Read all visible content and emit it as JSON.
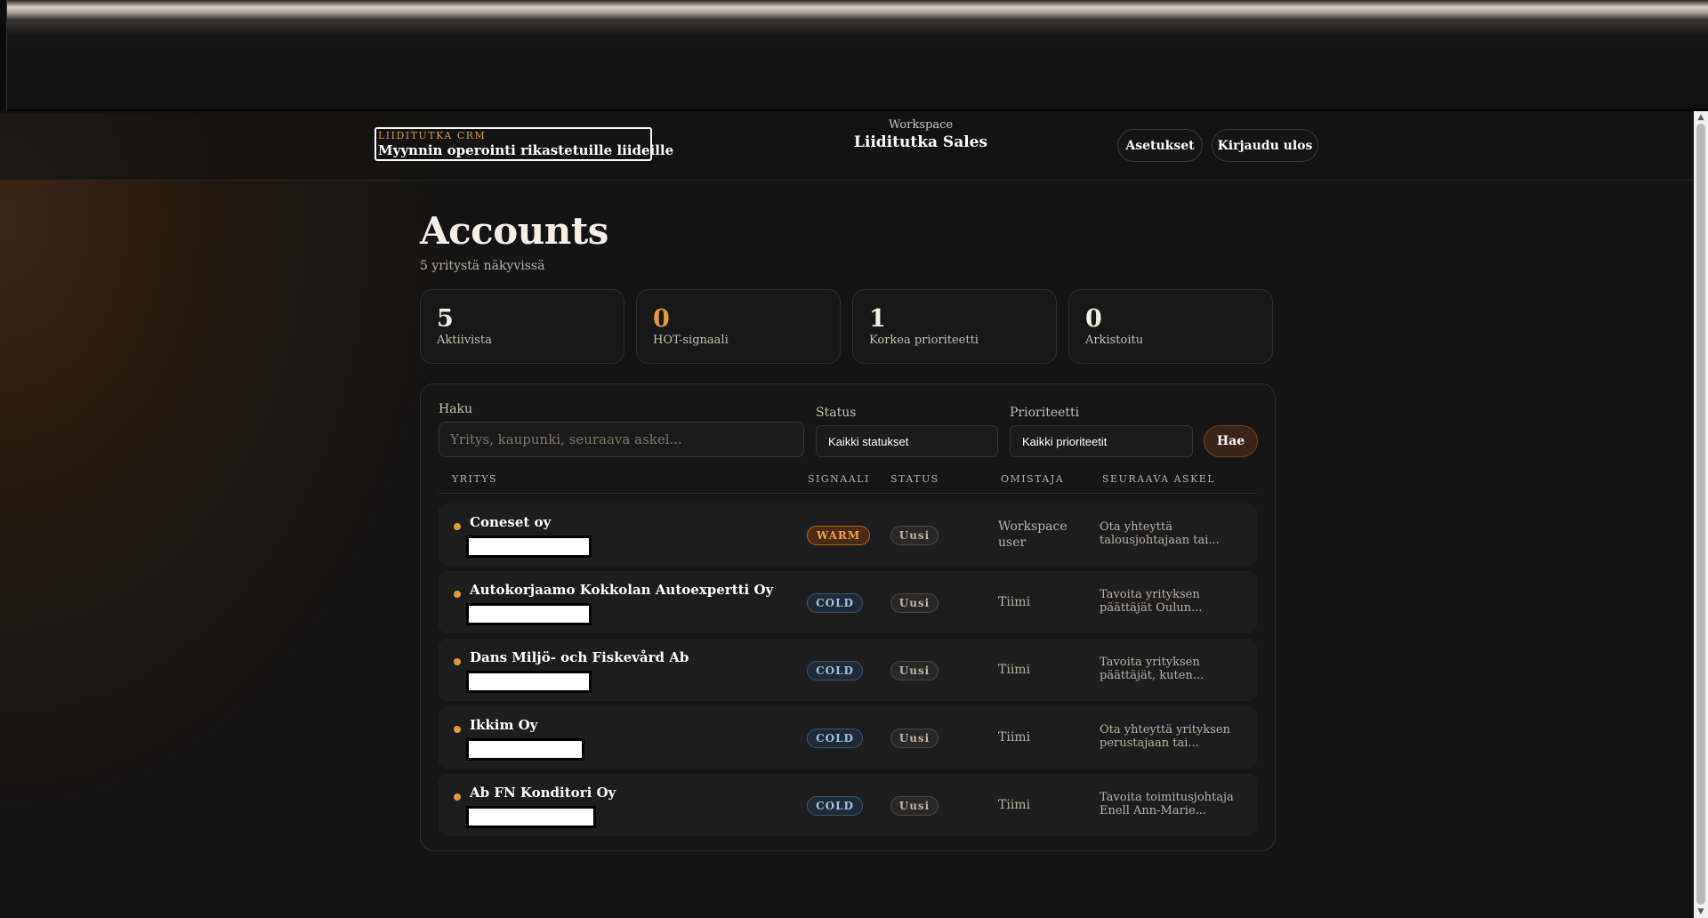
{
  "header": {
    "brand_kicker": "LIIDITUTKA CRM",
    "brand_title": "Myynnin operointi rikastetuille liideille",
    "workspace_label": "Workspace",
    "workspace_name": "Liiditutka Sales",
    "settings_label": "Asetukset",
    "logout_label": "Kirjaudu ulos"
  },
  "page": {
    "title": "Accounts",
    "subtitle": "5 yritystä näkyvissä"
  },
  "stats": [
    {
      "value": "5",
      "label": "Aktiivista"
    },
    {
      "value": "0",
      "label": "HOT-signaali"
    },
    {
      "value": "1",
      "label": "Korkea prioriteetti"
    },
    {
      "value": "0",
      "label": "Arkistoitu"
    }
  ],
  "filters": {
    "search_label": "Haku",
    "search_placeholder": "Yritys, kaupunki, seuraava askel...",
    "status_label": "Status",
    "status_value": "Kaikki statukset",
    "priority_label": "Prioriteetti",
    "priority_value": "Kaikki prioriteetit",
    "submit_label": "Hae"
  },
  "table": {
    "columns": [
      "YRITYS",
      "SIGNAALI",
      "STATUS",
      "OMISTAJA",
      "SEURAAVA ASKEL"
    ],
    "rows": [
      {
        "company": "Coneset oy",
        "signal": "WARM",
        "status": "Uusi",
        "owner_line1": "Workspace",
        "owner_line2": "user",
        "next_step": "Ota yhteyttä talousjohtajaan tai..."
      },
      {
        "company": "Autokorjaamo Kokkolan Autoexpertti Oy",
        "signal": "COLD",
        "status": "Uusi",
        "owner_line1": "Tiimi",
        "owner_line2": "",
        "next_step": "Tavoita yrityksen päättäjät Oulun..."
      },
      {
        "company": "Dans Miljö- och Fiskevård Ab",
        "signal": "COLD",
        "status": "Uusi",
        "owner_line1": "Tiimi",
        "owner_line2": "",
        "next_step": "Tavoita yrityksen päättäjät, kuten..."
      },
      {
        "company": "Ikkim Oy",
        "signal": "COLD",
        "status": "Uusi",
        "owner_line1": "Tiimi",
        "owner_line2": "",
        "next_step": "Ota yhteyttä yrityksen perustajaan tai..."
      },
      {
        "company": "Ab FN Konditori Oy",
        "signal": "COLD",
        "status": "Uusi",
        "owner_line1": "Tiimi",
        "owner_line2": "",
        "next_step": "Tavoita toimitusjohtaja Enell Ann-Marie..."
      }
    ]
  },
  "colors": {
    "accent": "#e39a3b",
    "warm": "#f0a24a",
    "cold": "#9fc3e6"
  }
}
